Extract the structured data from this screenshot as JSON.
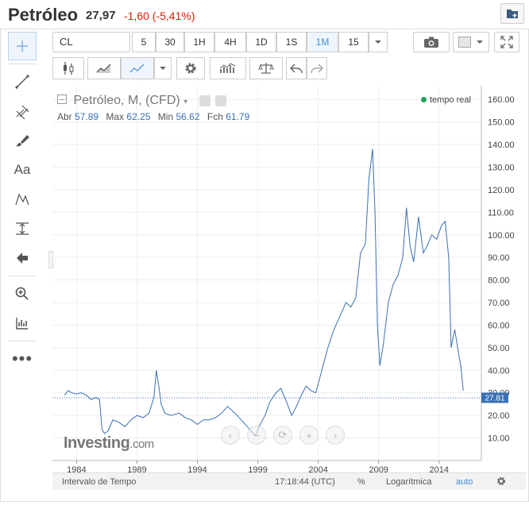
{
  "header": {
    "title": "Petróleo",
    "price": "27,97",
    "change": "-1,60 (-5,41%)"
  },
  "toolbar": {
    "symbol": "CL",
    "timeframes": [
      "5",
      "30",
      "1H",
      "4H",
      "1D",
      "1S",
      "1M",
      "15"
    ],
    "active_timeframe": "1M"
  },
  "legend": {
    "title": "Petróleo, M, (CFD)",
    "open_label": "Abr",
    "open": "57.89",
    "max_label": "Max",
    "max": "62.25",
    "min_label": "Min",
    "min": "56.62",
    "close_label": "Fch",
    "close": "61.79",
    "realtime": "tempo real"
  },
  "watermark": {
    "brand": "Investing",
    "domain": ".com"
  },
  "bottom": {
    "interval": "Intervalo de Tempo",
    "time": "17:18:44 (UTC)",
    "percent": "%",
    "log": "Logarítmica",
    "auto": "auto"
  },
  "colors": {
    "line": "#3a6fb5",
    "negative": "#d81e06",
    "accent": "#3f8fd8",
    "realtime_dot": "#21a35c"
  },
  "chart_data": {
    "type": "line",
    "y_ticks": [
      "160.00",
      "150.00",
      "140.00",
      "130.00",
      "120.00",
      "110.00",
      "100.00",
      "90.00",
      "80.00",
      "70.00",
      "60.00",
      "50.00",
      "40.00",
      "30.00",
      "20.00",
      "10.00"
    ],
    "x_ticks": [
      "1984",
      "1989",
      "1994",
      "1999",
      "2004",
      "2009",
      "2014"
    ],
    "ylim": [
      0,
      165
    ],
    "xlim": [
      1982,
      2017.5
    ],
    "current_value": "27.81",
    "series": [
      {
        "x": [
          1983.0,
          1983.3,
          1983.6,
          1984.0,
          1984.4,
          1984.8,
          1985.2,
          1985.6,
          1985.9,
          1986.1,
          1986.3,
          1986.6,
          1987.0,
          1987.5,
          1988.0,
          1988.5,
          1989.0,
          1989.5,
          1990.0,
          1990.4,
          1990.6,
          1990.8,
          1991.0,
          1991.3,
          1991.8,
          1992.5,
          1993.0,
          1993.5,
          1994.0,
          1994.5,
          1995.0,
          1995.5,
          1996.0,
          1996.5,
          1996.9,
          1997.3,
          1997.8,
          1998.3,
          1998.8,
          1999.2,
          1999.6,
          2000.0,
          2000.5,
          2000.9,
          2001.3,
          2001.8,
          2002.2,
          2002.6,
          2003.0,
          2003.4,
          2003.8,
          2004.3,
          2004.8,
          2005.3,
          2005.8,
          2006.3,
          2006.7,
          2007.1,
          2007.5,
          2007.9,
          2008.2,
          2008.5,
          2008.7,
          2008.9,
          2009.1,
          2009.4,
          2009.8,
          2010.2,
          2010.6,
          2011.0,
          2011.3,
          2011.6,
          2011.9,
          2012.3,
          2012.7,
          2013.0,
          2013.4,
          2013.8,
          2014.2,
          2014.5,
          2014.8,
          2015.0,
          2015.3,
          2015.6,
          2015.8,
          2016.0
        ],
        "y": [
          29,
          31,
          30,
          29.5,
          30,
          29,
          27,
          28,
          27,
          14,
          12,
          13,
          18,
          17,
          15,
          18,
          20,
          19,
          21,
          28,
          40,
          33,
          25,
          21,
          20,
          21,
          19,
          18,
          16,
          18,
          18,
          19,
          21,
          24,
          22,
          20,
          17,
          14,
          11,
          16,
          20,
          26,
          30,
          32,
          27,
          20,
          24,
          29,
          33,
          31,
          30,
          40,
          50,
          58,
          64,
          70,
          68,
          72,
          92,
          96,
          125,
          138,
          110,
          60,
          42,
          52,
          70,
          78,
          82,
          90,
          112,
          95,
          88,
          108,
          92,
          95,
          100,
          98,
          104,
          106,
          90,
          50,
          58,
          48,
          42,
          31
        ]
      }
    ]
  }
}
